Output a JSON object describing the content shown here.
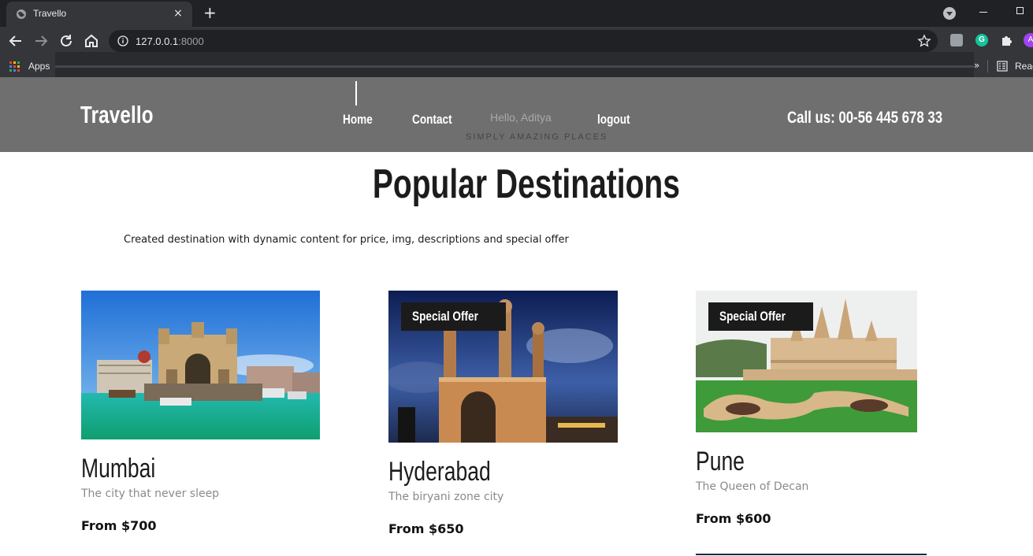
{
  "browser": {
    "tab_title": "Travello",
    "tab_close": "×",
    "new_tab": "+",
    "url_host": "127.0.0.1",
    "url_port": ":8000",
    "bookmarks_apps": "Apps",
    "bookmarks_more": "»",
    "reading_list": "Reac",
    "avatar_letter": "A"
  },
  "header": {
    "logo": "Travello",
    "nav": {
      "home": "Home",
      "contact": "Contact",
      "greeting": "Hello, Aditya",
      "logout": "logout"
    },
    "tagline": "SIMPLY AMAZING PLACES",
    "call": "Call us: 00-56 445 678 33"
  },
  "main": {
    "title": "Popular Destinations",
    "subtitle": "Created destination with dynamic content for price, img, descriptions and special offer",
    "destinations": [
      {
        "name": "Mumbai",
        "description": "The city that never sleep",
        "price": "From $700",
        "offer": "",
        "image": "gateway-of-india-photo"
      },
      {
        "name": "Hyderabad",
        "description": "The biryani zone city",
        "price": "From $650",
        "offer": "Special Offer",
        "image": "charminar-photo"
      },
      {
        "name": "Pune",
        "description": "The Queen of Decan",
        "price": "From $600",
        "offer": "Special Offer",
        "image": "temple-garden-photo"
      }
    ]
  },
  "colors": {
    "header_bg": "#6f6f6f",
    "offer_bg": "#1b1b1b",
    "chrome_dark": "#202124",
    "chrome_mid": "#35363a"
  }
}
